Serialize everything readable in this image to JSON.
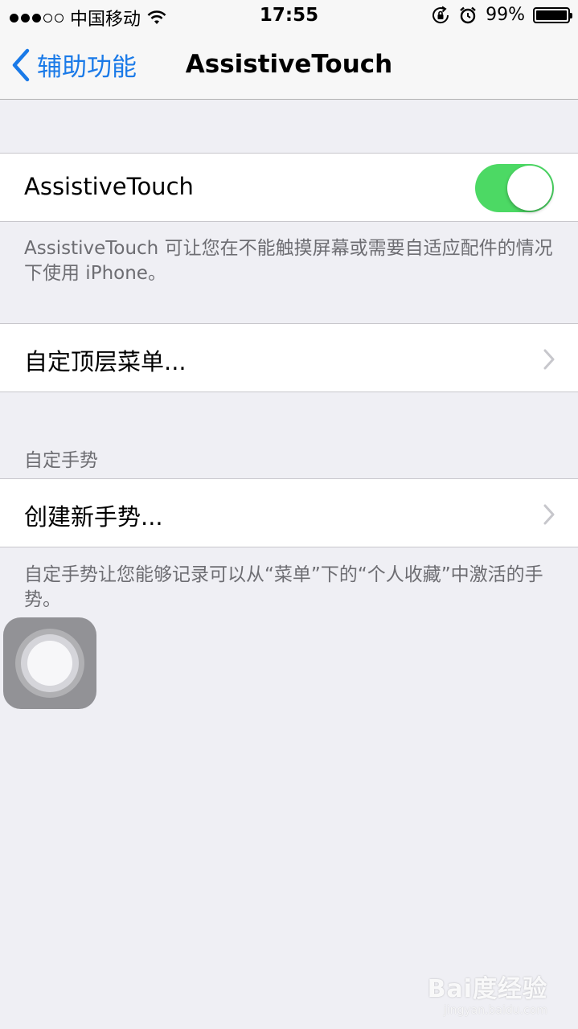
{
  "status_bar": {
    "signal_full": 3,
    "signal_total": 5,
    "carrier": "中国移动",
    "time": "17:55",
    "battery_percent": "99%",
    "battery_level": 0.99
  },
  "nav": {
    "back_label": "辅助功能",
    "title": "AssistiveTouch"
  },
  "assistive_toggle": {
    "label": "AssistiveTouch",
    "on": true,
    "description": "AssistiveTouch 可让您在不能触摸屏幕或需要自适应配件的情况下使用 iPhone。"
  },
  "customize_menu": {
    "label": "自定顶层菜单..."
  },
  "gestures": {
    "header": "自定手势",
    "create_label": "创建新手势...",
    "description": "自定手势让您能够记录可以从“菜单”下的“个人收藏”中激活的手势。"
  },
  "watermark": {
    "main": "Bai度经验",
    "sub": "jingyan.baidu.com"
  },
  "colors": {
    "accent": "#1a7ae8",
    "toggle_on": "#4cd964",
    "background": "#efeff4"
  }
}
